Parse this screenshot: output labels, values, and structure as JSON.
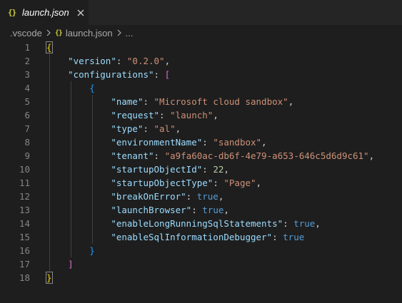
{
  "tab": {
    "title": "launch.json",
    "icon": "json-braces-icon"
  },
  "breadcrumb": {
    "folder": ".vscode",
    "file": "launch.json",
    "more": "..."
  },
  "editor": {
    "line_numbers": [
      "1",
      "2",
      "3",
      "4",
      "5",
      "6",
      "7",
      "8",
      "9",
      "10",
      "11",
      "12",
      "13",
      "14",
      "15",
      "16",
      "17",
      "18"
    ],
    "code": {
      "open_brace": "{",
      "version_key": "\"version\"",
      "version_value": "\"0.2.0\"",
      "configurations_key": "\"configurations\"",
      "open_bracket": "[",
      "inner_open": "{",
      "name_key": "\"name\"",
      "name_value": "\"Microsoft cloud sandbox\"",
      "request_key": "\"request\"",
      "request_value": "\"launch\"",
      "type_key": "\"type\"",
      "type_value": "\"al\"",
      "environmentName_key": "\"environmentName\"",
      "environmentName_value": "\"sandbox\"",
      "tenant_key": "\"tenant\"",
      "tenant_value": "\"a9fa60ac-db6f-4e79-a653-646c5d6d9c61\"",
      "startupObjectId_key": "\"startupObjectId\"",
      "startupObjectId_value": "22",
      "startupObjectType_key": "\"startupObjectType\"",
      "startupObjectType_value": "\"Page\"",
      "breakOnError_key": "\"breakOnError\"",
      "breakOnError_value": "true",
      "launchBrowser_key": "\"launchBrowser\"",
      "launchBrowser_value": "true",
      "enableLongRunningSqlStatements_key": "\"enableLongRunningSqlStatements\"",
      "enableLongRunningSqlStatements_value": "true",
      "enableSqlInformationDebugger_key": "\"enableSqlInformationDebugger\"",
      "enableSqlInformationDebugger_value": "true",
      "inner_close": "}",
      "close_bracket": "]",
      "close_brace": "}"
    }
  },
  "colors": {
    "background": "#1e1e1e",
    "key": "#9cdcfe",
    "string": "#ce9178",
    "number": "#b5cea8",
    "boolean": "#569cd6",
    "bracket_level1": "#ffd700",
    "bracket_level2": "#da70d6",
    "bracket_level3": "#179fff"
  }
}
